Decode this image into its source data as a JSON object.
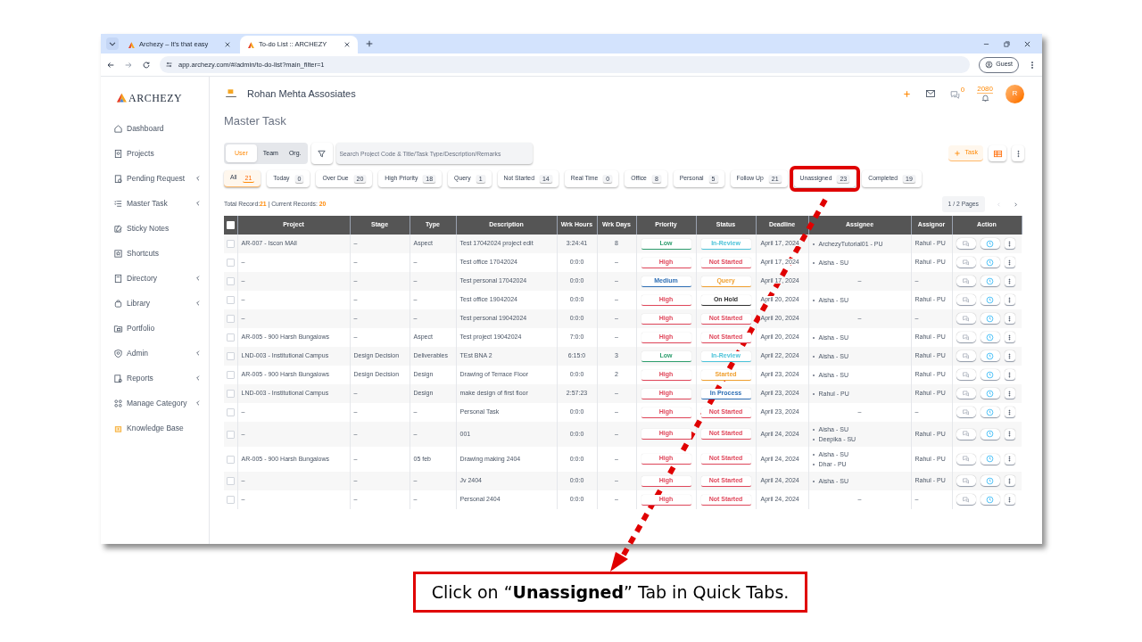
{
  "browser": {
    "tabs": [
      {
        "title": "Archezy – It's that easy",
        "selected": false
      },
      {
        "title": "To-do List :: ARCHEZY",
        "selected": true
      }
    ],
    "url": "app.archezy.com/#/admin/to-do-list?main_filter=1",
    "profile": "Guest"
  },
  "sidebar": {
    "logo": "ARCHEZY",
    "items": [
      {
        "label": "Dashboard",
        "expandable": false
      },
      {
        "label": "Projects",
        "expandable": false
      },
      {
        "label": "Pending Request",
        "expandable": true
      },
      {
        "label": "Master Task",
        "expandable": true
      },
      {
        "label": "Sticky Notes",
        "expandable": false
      },
      {
        "label": "Shortcuts",
        "expandable": false
      },
      {
        "label": "Directory",
        "expandable": true
      },
      {
        "label": "Library",
        "expandable": true
      },
      {
        "label": "Portfolio",
        "expandable": false
      },
      {
        "label": "Admin",
        "expandable": true
      },
      {
        "label": "Reports",
        "expandable": true
      },
      {
        "label": "Manage Category",
        "expandable": true
      },
      {
        "label": "Knowledge Base",
        "expandable": false
      }
    ]
  },
  "header": {
    "company": "Rohan Mehta Assosiates",
    "chat_count": "0",
    "notification_count": "2080",
    "avatar": "R"
  },
  "page_title": "Master Task",
  "scope": [
    {
      "label": "User",
      "selected": true
    },
    {
      "label": "Team",
      "selected": false
    },
    {
      "label": "Org.",
      "selected": false
    }
  ],
  "search": {
    "placeholder": "Search Project Code & Title/Task Type/Description/Remarks"
  },
  "add_button": "Task",
  "quick_tabs": [
    {
      "label": "All",
      "count": "21",
      "selected": true,
      "highlighted": false
    },
    {
      "label": "Today",
      "count": "0",
      "selected": false,
      "highlighted": false
    },
    {
      "label": "Over Due",
      "count": "20",
      "selected": false,
      "highlighted": false
    },
    {
      "label": "High Priority",
      "count": "18",
      "selected": false,
      "highlighted": false
    },
    {
      "label": "Query",
      "count": "1",
      "selected": false,
      "highlighted": false
    },
    {
      "label": "Not Started",
      "count": "14",
      "selected": false,
      "highlighted": false
    },
    {
      "label": "Real Time",
      "count": "0",
      "selected": false,
      "highlighted": false
    },
    {
      "label": "Office",
      "count": "8",
      "selected": false,
      "highlighted": false
    },
    {
      "label": "Personal",
      "count": "5",
      "selected": false,
      "highlighted": false
    },
    {
      "label": "Follow Up",
      "count": "21",
      "selected": false,
      "highlighted": false
    },
    {
      "label": "Unassigned",
      "count": "23",
      "selected": false,
      "highlighted": true
    },
    {
      "label": "Completed",
      "count": "19",
      "selected": false,
      "highlighted": false
    }
  ],
  "records": "Total Record:**21** | Current Records: **20**",
  "pagination": "1 / 2 Pages",
  "table": {
    "select_all_checked": false,
    "columns": [
      "Project",
      "Stage",
      "Type",
      "Description",
      "Wrk Hours",
      "Wrk Days",
      "Priority",
      "Status",
      "Deadline",
      "Assignee",
      "Assignor",
      "Action"
    ],
    "rows": [
      {
        "checked": false,
        "project": "AR-007 - Iscon MAll",
        "stage": "–",
        "type": "Aspect",
        "description": "Test 17042024 project edit",
        "hours": "3:24:41",
        "days": "8",
        "priority": {
          "label": "Low",
          "color": "#2e9e6e"
        },
        "status": {
          "label": "In-Review",
          "color": "#4cc3d9"
        },
        "deadline": "April 17, 2024",
        "assignees": [
          "ArchezyTutorial01 - PU"
        ],
        "assignor": "Rahul - PU"
      },
      {
        "checked": false,
        "project": "–",
        "stage": "–",
        "type": "–",
        "description": "Test office 17042024",
        "hours": "0:0:0",
        "days": "–",
        "priority": {
          "label": "High",
          "color": "#e0475b"
        },
        "status": {
          "label": "Not Started",
          "color": "#e0475b"
        },
        "deadline": "April 17, 2024",
        "assignees": [
          "Aisha - SU"
        ],
        "assignor": "Rahul - PU"
      },
      {
        "checked": false,
        "project": "–",
        "stage": "–",
        "type": "–",
        "description": "Test personal 17042024",
        "hours": "0:0:0",
        "days": "–",
        "priority": {
          "label": "Medium",
          "color": "#2f6fb5"
        },
        "status": {
          "label": "Query",
          "color": "#f0a030"
        },
        "deadline": "April 17, 2024",
        "assignee": "–",
        "assignor": "–"
      },
      {
        "checked": false,
        "project": "–",
        "stage": "–",
        "type": "–",
        "description": "Test office 19042024",
        "hours": "0:0:0",
        "days": "–",
        "priority": {
          "label": "High",
          "color": "#e0475b"
        },
        "status": {
          "label": "On Hold",
          "color": "#333333"
        },
        "deadline": "April 20, 2024",
        "assignees": [
          "Aisha - SU"
        ],
        "assignor": "Rahul - PU"
      },
      {
        "checked": false,
        "project": "–",
        "stage": "–",
        "type": "–",
        "description": "Test personal 19042024",
        "hours": "0:0:0",
        "days": "–",
        "priority": {
          "label": "High",
          "color": "#e0475b"
        },
        "status": {
          "label": "Not Started",
          "color": "#e0475b"
        },
        "deadline": "April 20, 2024",
        "assignee": "–",
        "assignor": "–"
      },
      {
        "checked": false,
        "project": "AR-005 - 900 Harsh Bungalows",
        "stage": "–",
        "type": "Aspect",
        "description": "Test project 19042024",
        "hours": "7:0:0",
        "days": "–",
        "priority": {
          "label": "High",
          "color": "#e0475b"
        },
        "status": {
          "label": "Not Started",
          "color": "#e0475b"
        },
        "deadline": "April 20, 2024",
        "assignees": [
          "Aisha - SU"
        ],
        "assignor": "Rahul - PU"
      },
      {
        "checked": false,
        "project": "LND-003 - Institutional Campus",
        "stage": "Design Decision",
        "type": "Deliverables",
        "description": "TEst BNA 2",
        "hours": "6:15:0",
        "days": "3",
        "priority": {
          "label": "Low",
          "color": "#2e9e6e"
        },
        "status": {
          "label": "In-Review",
          "color": "#4cc3d9"
        },
        "deadline": "April 22, 2024",
        "assignees": [
          "Aisha - SU"
        ],
        "assignor": "Rahul - PU"
      },
      {
        "checked": false,
        "project": "AR-005 - 900 Harsh Bungalows",
        "stage": "Design Decision",
        "type": "Design",
        "description": "Drawing of Terrace Floor",
        "hours": "0:0:0",
        "days": "2",
        "priority": {
          "label": "High",
          "color": "#e0475b"
        },
        "status": {
          "label": "Started",
          "color": "#f0a030"
        },
        "deadline": "April 23, 2024",
        "assignees": [
          "Aisha - SU"
        ],
        "assignor": "Rahul - PU"
      },
      {
        "checked": false,
        "project": "LND-003 - Institutional Campus",
        "stage": "–",
        "type": "Design",
        "description": "make design of first floor",
        "hours": "2:57:23",
        "days": "–",
        "priority": {
          "label": "High",
          "color": "#e0475b"
        },
        "status": {
          "label": "In Process",
          "color": "#2f6fb5"
        },
        "deadline": "April 23, 2024",
        "assignees": [
          "Rahul - PU"
        ],
        "assignor": "Rahul - PU"
      },
      {
        "checked": false,
        "project": "–",
        "stage": "–",
        "type": "–",
        "description": "Personal Task",
        "hours": "0:0:0",
        "days": "–",
        "priority": {
          "label": "High",
          "color": "#e0475b"
        },
        "status": {
          "label": "Not Started",
          "color": "#e0475b"
        },
        "deadline": "April 23, 2024",
        "assignee": "–",
        "assignor": "–"
      },
      {
        "checked": false,
        "project": "–",
        "stage": "–",
        "type": "–",
        "description": "001",
        "hours": "0:0:0",
        "days": "–",
        "priority": {
          "label": "High",
          "color": "#e0475b"
        },
        "status": {
          "label": "Not Started",
          "color": "#e0475b"
        },
        "deadline": "April 24, 2024",
        "assignees": [
          "Aisha - SU",
          "Deepika - SU"
        ],
        "assignor": "Rahul - PU"
      },
      {
        "checked": false,
        "project": "AR-005 - 900 Harsh Bungalows",
        "stage": "–",
        "type": "05 feb",
        "description": "Drawing making 2404",
        "hours": "0:0:0",
        "days": "–",
        "priority": {
          "label": "High",
          "color": "#e0475b"
        },
        "status": {
          "label": "Not Started",
          "color": "#e0475b"
        },
        "deadline": "April 24, 2024",
        "assignees": [
          "Aisha - SU",
          "Dhar - PU"
        ],
        "assignor": "Rahul - PU"
      },
      {
        "checked": false,
        "project": "–",
        "stage": "–",
        "type": "–",
        "description": "Jv 2404",
        "hours": "0:0:0",
        "days": "–",
        "priority": {
          "label": "High",
          "color": "#e0475b"
        },
        "status": {
          "label": "Not Started",
          "color": "#e0475b"
        },
        "deadline": "April 24, 2024",
        "assignees": [
          "Aisha - SU"
        ],
        "assignor": "Rahul - PU"
      },
      {
        "checked": false,
        "project": "–",
        "stage": "–",
        "type": "–",
        "description": "Personal 2404",
        "hours": "0:0:0",
        "days": "–",
        "priority": {
          "label": "High",
          "color": "#e0475b"
        },
        "status": {
          "label": "Not Started",
          "color": "#e0475b"
        },
        "deadline": "April 24, 2024",
        "assignee": "–",
        "assignor": "–"
      }
    ]
  },
  "callout": "Click on “**Unassigned**” Tab in Quick Tabs."
}
